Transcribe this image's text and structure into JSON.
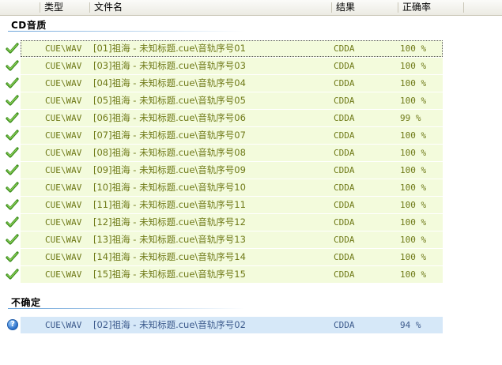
{
  "columns": {
    "type": "类型",
    "filename": "文件名",
    "result": "结果",
    "accuracy": "正确率"
  },
  "groups": [
    {
      "title": "CD音质",
      "status": "ok",
      "rows": [
        {
          "type": "CUE\\WAV",
          "name": "[01]祖海 - 未知标题.cue\\音轨序号01",
          "result": "CDDA",
          "rate": "100 %"
        },
        {
          "type": "CUE\\WAV",
          "name": "[03]祖海 - 未知标题.cue\\音轨序号03",
          "result": "CDDA",
          "rate": "100 %"
        },
        {
          "type": "CUE\\WAV",
          "name": "[04]祖海 - 未知标题.cue\\音轨序号04",
          "result": "CDDA",
          "rate": "100 %"
        },
        {
          "type": "CUE\\WAV",
          "name": "[05]祖海 - 未知标题.cue\\音轨序号05",
          "result": "CDDA",
          "rate": "100 %"
        },
        {
          "type": "CUE\\WAV",
          "name": "[06]祖海 - 未知标题.cue\\音轨序号06",
          "result": "CDDA",
          "rate": "99 %"
        },
        {
          "type": "CUE\\WAV",
          "name": "[07]祖海 - 未知标题.cue\\音轨序号07",
          "result": "CDDA",
          "rate": "100 %"
        },
        {
          "type": "CUE\\WAV",
          "name": "[08]祖海 - 未知标题.cue\\音轨序号08",
          "result": "CDDA",
          "rate": "100 %"
        },
        {
          "type": "CUE\\WAV",
          "name": "[09]祖海 - 未知标题.cue\\音轨序号09",
          "result": "CDDA",
          "rate": "100 %"
        },
        {
          "type": "CUE\\WAV",
          "name": "[10]祖海 - 未知标题.cue\\音轨序号10",
          "result": "CDDA",
          "rate": "100 %"
        },
        {
          "type": "CUE\\WAV",
          "name": "[11]祖海 - 未知标题.cue\\音轨序号11",
          "result": "CDDA",
          "rate": "100 %"
        },
        {
          "type": "CUE\\WAV",
          "name": "[12]祖海 - 未知标题.cue\\音轨序号12",
          "result": "CDDA",
          "rate": "100 %"
        },
        {
          "type": "CUE\\WAV",
          "name": "[13]祖海 - 未知标题.cue\\音轨序号13",
          "result": "CDDA",
          "rate": "100 %"
        },
        {
          "type": "CUE\\WAV",
          "name": "[14]祖海 - 未知标题.cue\\音轨序号14",
          "result": "CDDA",
          "rate": "100 %"
        },
        {
          "type": "CUE\\WAV",
          "name": "[15]祖海 - 未知标题.cue\\音轨序号15",
          "result": "CDDA",
          "rate": "100 %"
        }
      ]
    },
    {
      "title": "不确定",
      "status": "unknown",
      "rows": [
        {
          "type": "CUE\\WAV",
          "name": "[02]祖海 - 未知标题.cue\\音轨序号02",
          "result": "CDDA",
          "rate": "94 %"
        }
      ]
    }
  ],
  "icons": {
    "ok": "green-check-icon",
    "unknown": "blue-question-icon"
  },
  "colors": {
    "ok_row_bg": "#f3fbdc",
    "ok_text": "#6f7a18",
    "unknown_row_bg": "#d6e8f8",
    "unknown_text": "#3c5a8c",
    "check_green": "#5aa82a"
  }
}
